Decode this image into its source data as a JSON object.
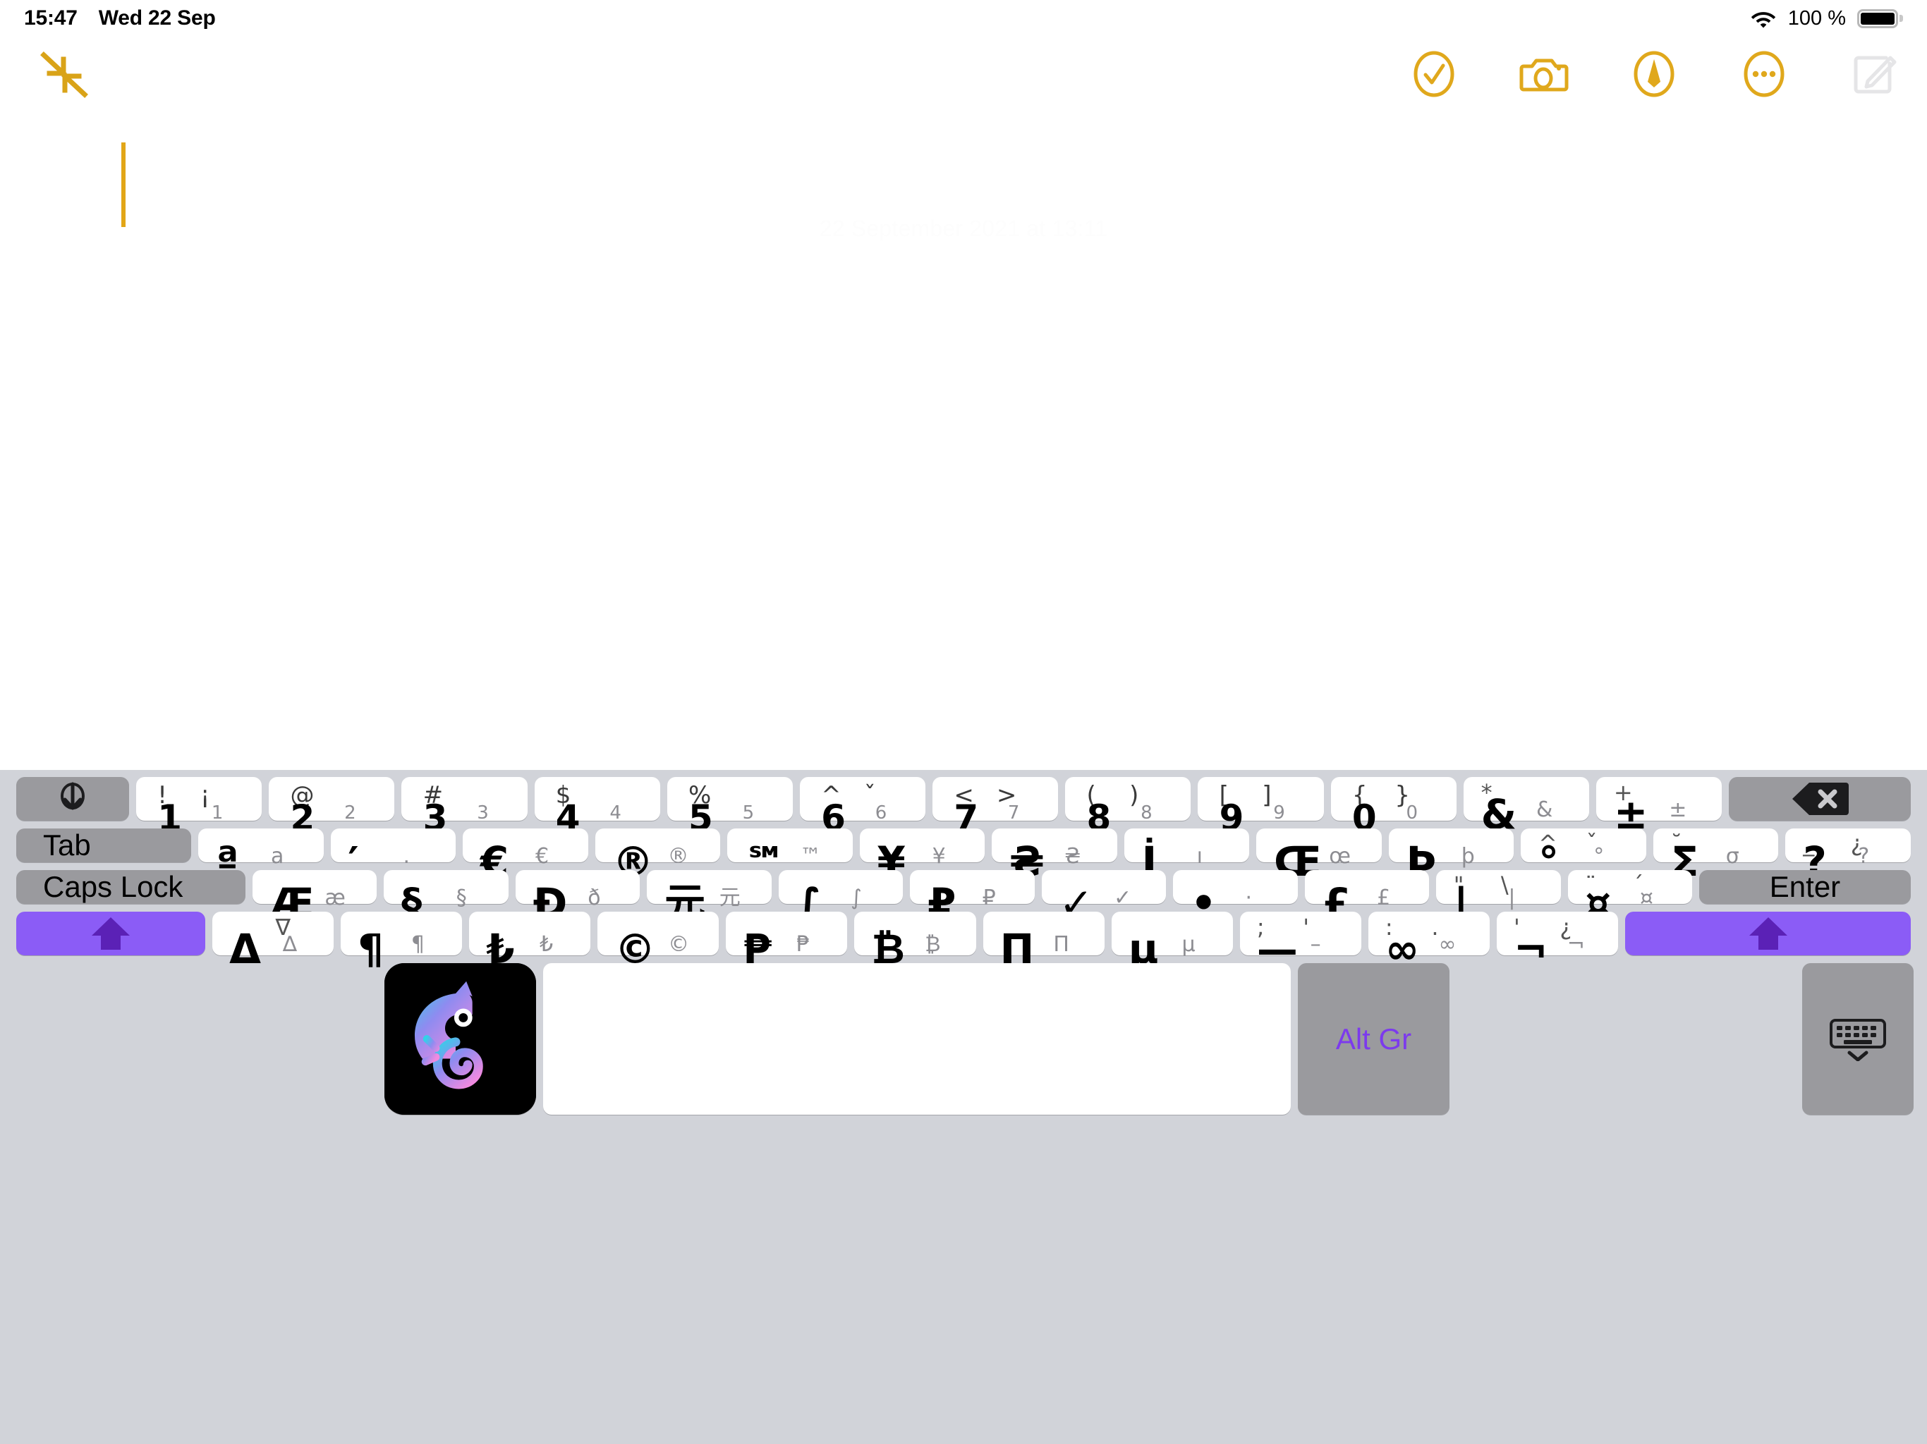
{
  "status_bar": {
    "time": "15:47",
    "date": "Wed 22 Sep",
    "battery_percent": "100 %",
    "wifi_icon": "wifi-icon",
    "battery_icon": "battery-full-icon"
  },
  "note_toolbar": {
    "collapse_icon": "collapse-arrows-icon",
    "actions": [
      {
        "name": "checklist-button",
        "icon": "checkmark-circle-icon",
        "color": "#e0a81c"
      },
      {
        "name": "camera-button",
        "icon": "camera-icon",
        "color": "#e0a81c"
      },
      {
        "name": "markup-button",
        "icon": "markup-pen-circle-icon",
        "color": "#e0a81c"
      },
      {
        "name": "more-button",
        "icon": "ellipsis-circle-icon",
        "color": "#e0a81c"
      },
      {
        "name": "compose-button",
        "icon": "compose-icon",
        "color": "#e5e5e7"
      }
    ]
  },
  "note": {
    "date_header": "22 September 2021 at 13:11",
    "body_text": "",
    "caret_color": "#e2a617"
  },
  "keyboard": {
    "background": "#d1d3d9",
    "key_color": "#ffffff",
    "modifier_color": "#9a9a9e",
    "shift_color": "#8b5cf6",
    "accent_text": "#7c3aed",
    "labels": {
      "tab": "Tab",
      "caps_lock": "Caps Lock",
      "enter": "Enter",
      "alt_gr": "Alt Gr"
    },
    "icons": {
      "globe": "globe-down-arrow-icon",
      "delete": "delete-backward-icon",
      "shift_left": "shift-up-arrow-icon",
      "shift_right": "shift-up-arrow-icon",
      "app": "chameleon-app-icon",
      "dismiss": "hide-keyboard-icon"
    },
    "rows": [
      {
        "name": "number-row",
        "keys": [
          {
            "name": "key-1",
            "style": "quad",
            "tl": "!",
            "tr": "¡",
            "bl": "1",
            "br": "1"
          },
          {
            "name": "key-2",
            "style": "quad",
            "tl": "@",
            "tr": "",
            "bl": "2",
            "br": "2"
          },
          {
            "name": "key-3",
            "style": "quad",
            "tl": "#",
            "tr": "",
            "bl": "3",
            "br": "3"
          },
          {
            "name": "key-4",
            "style": "quad",
            "tl": "$",
            "tr": "",
            "bl": "4",
            "br": "4"
          },
          {
            "name": "key-5",
            "style": "quad",
            "tl": "%",
            "tr": "",
            "bl": "5",
            "br": "5"
          },
          {
            "name": "key-6",
            "style": "quad",
            "tl": "^",
            "tr": "ˇ",
            "bl": "6",
            "br": "6"
          },
          {
            "name": "key-7",
            "style": "quad",
            "tl": "<",
            "tr": ">",
            "bl": "7",
            "br": "7"
          },
          {
            "name": "key-8",
            "style": "quad",
            "tl": "(",
            "tr": ")",
            "bl": "8",
            "br": "8"
          },
          {
            "name": "key-9",
            "style": "quad",
            "tl": "[",
            "tr": "]",
            "bl": "9",
            "br": "9"
          },
          {
            "name": "key-0",
            "style": "quad",
            "tl": "{",
            "tr": "}",
            "bl": "0",
            "br": "0"
          },
          {
            "name": "key-ampersand",
            "style": "big",
            "tl": "*",
            "tr": "",
            "main": "&",
            "alt": "&"
          },
          {
            "name": "key-plusminus",
            "style": "big",
            "tl": "+",
            "tr": "",
            "main": "±",
            "alt": "±"
          }
        ]
      },
      {
        "name": "tab-row",
        "keys": [
          {
            "name": "key-ordinal-a",
            "style": "big",
            "tl": "",
            "tr": "",
            "main": "ª",
            "alt": "a"
          },
          {
            "name": "key-prime",
            "style": "big",
            "tl": "",
            "tr": "",
            "main": "′",
            "alt": "."
          },
          {
            "name": "key-euro",
            "style": "big",
            "tl": "",
            "tr": "",
            "main": "€",
            "alt": "€"
          },
          {
            "name": "key-registered",
            "style": "big",
            "tl": "",
            "tr": "",
            "main": "®",
            "alt": "®"
          },
          {
            "name": "key-servicemark",
            "style": "big",
            "tl": "",
            "tr": "",
            "main": "℠",
            "alt": "™"
          },
          {
            "name": "key-yen",
            "style": "big",
            "tl": "",
            "tr": "",
            "main": "¥",
            "alt": "¥"
          },
          {
            "name": "key-hryvnia",
            "style": "big",
            "tl": "",
            "tr": "",
            "main": "₴",
            "alt": "₴"
          },
          {
            "name": "key-dotted-i",
            "style": "big",
            "tl": "",
            "tr": "",
            "main": "İ",
            "alt": "ı"
          },
          {
            "name": "key-oe-ligature",
            "style": "big",
            "tl": "",
            "tr": "",
            "main": "Œ",
            "alt": "œ"
          },
          {
            "name": "key-thorn",
            "style": "big",
            "tl": "",
            "tr": "",
            "main": "Þ",
            "alt": "þ"
          },
          {
            "name": "key-degree",
            "style": "big",
            "tl": "^",
            "tr": "ˇ",
            "main": "°",
            "alt": "°"
          },
          {
            "name": "key-sigma",
            "style": "big",
            "tl": "˘",
            "tr": "",
            "main": "Σ",
            "alt": "σ"
          },
          {
            "name": "key-question",
            "style": "big",
            "tl": "_",
            "tr": "¿",
            "main": "?",
            "alt": "?"
          }
        ]
      },
      {
        "name": "home-row",
        "keys": [
          {
            "name": "key-ae-ligature",
            "style": "big",
            "tl": "",
            "tr": "",
            "main": "Æ",
            "alt": "æ"
          },
          {
            "name": "key-section",
            "style": "big",
            "tl": "",
            "tr": "",
            "main": "§",
            "alt": "§"
          },
          {
            "name": "key-eth",
            "style": "big",
            "tl": "",
            "tr": "",
            "main": "Đ",
            "alt": "ð"
          },
          {
            "name": "key-yuan",
            "style": "big",
            "tl": "",
            "tr": "",
            "main": "元",
            "alt": "元"
          },
          {
            "name": "key-integral",
            "style": "big",
            "tl": "",
            "tr": "",
            "main": "∫",
            "alt": "∫"
          },
          {
            "name": "key-ruble",
            "style": "big",
            "tl": "",
            "tr": "",
            "main": "₽",
            "alt": "₽"
          },
          {
            "name": "key-checkmark",
            "style": "big",
            "tl": "",
            "tr": "",
            "main": "✓",
            "alt": "✓"
          },
          {
            "name": "key-bullet",
            "style": "big",
            "tl": "",
            "tr": "",
            "main": "•",
            "alt": "·"
          },
          {
            "name": "key-pound",
            "style": "big",
            "tl": "",
            "tr": "",
            "main": "£",
            "alt": "£"
          },
          {
            "name": "key-pipe",
            "style": "big",
            "tl": "\"",
            "tr": "\\",
            "main": "|",
            "alt": "|"
          },
          {
            "name": "key-currency",
            "style": "big",
            "tl": "¨",
            "tr": "´",
            "main": "¤",
            "alt": "¤"
          }
        ]
      },
      {
        "name": "shift-row",
        "keys": [
          {
            "name": "key-delta",
            "style": "big",
            "tl": "",
            "tr": "∇",
            "main": "Δ",
            "alt": "∆"
          },
          {
            "name": "key-pilcrow",
            "style": "big",
            "tl": "",
            "tr": "",
            "main": "¶",
            "alt": "¶"
          },
          {
            "name": "key-lira",
            "style": "big",
            "tl": "",
            "tr": "",
            "main": "₺",
            "alt": "₺"
          },
          {
            "name": "key-copyright",
            "style": "big",
            "tl": "",
            "tr": "",
            "main": "©",
            "alt": "©"
          },
          {
            "name": "key-peso",
            "style": "big",
            "tl": "",
            "tr": "",
            "main": "₱",
            "alt": "₱"
          },
          {
            "name": "key-bitcoin",
            "style": "big",
            "tl": "",
            "tr": "",
            "main": "₿",
            "alt": "₿"
          },
          {
            "name": "key-pi-capital",
            "style": "big",
            "tl": "",
            "tr": "",
            "main": "Π",
            "alt": "Π"
          },
          {
            "name": "key-mu",
            "style": "big",
            "tl": "",
            "tr": "",
            "main": "μ",
            "alt": "µ"
          },
          {
            "name": "key-emdash",
            "style": "big",
            "tl": ";",
            "tr": "'",
            "main": "—",
            "alt": "–"
          },
          {
            "name": "key-infinity",
            "style": "big",
            "tl": ":",
            "tr": ".",
            "main": "∞",
            "alt": "∞"
          },
          {
            "name": "key-not-sign",
            "style": "big",
            "tl": "'",
            "tr": "¿",
            "main": "¬",
            "alt": "¬"
          }
        ]
      }
    ]
  }
}
